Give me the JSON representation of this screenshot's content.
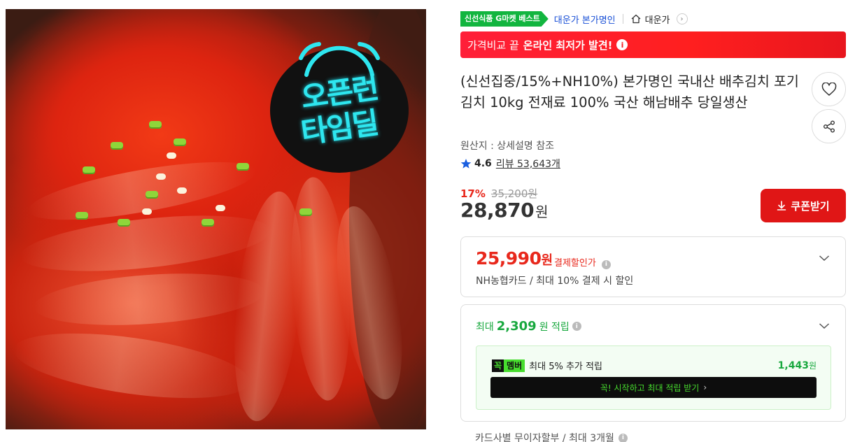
{
  "image": {
    "badge_line1": "오픈런",
    "badge_line2": "타임딜",
    "clock_icon": "alarm-clock-icon"
  },
  "tags": {
    "best_badge": "신선식품 G마켓 베스트",
    "brand": "대운가 본가명인",
    "home_label": "대운가"
  },
  "banner": {
    "prefix": "가격비교 끝",
    "highlight": "온라인 최저가 발견!"
  },
  "product": {
    "title": "(신선집중/15%+NH10%) 본가명인 국내산 배추김치 포기김치 10kg 전재료 100% 국산 해남배추 당일생산",
    "origin": "원산지 : 상세설명 참조",
    "rating": "4.6",
    "review_label": "리뷰 53,643개"
  },
  "price": {
    "discount_rate": "17%",
    "original": "35,200원",
    "final_number": "28,870",
    "final_unit": "원",
    "coupon_label": "쿠폰받기"
  },
  "payment_box": {
    "price_number": "25,990",
    "price_unit": "원",
    "label": "결제할인가",
    "description": "NH농협카드 / 최대 10% 결제 시 할인"
  },
  "points_box": {
    "prefix": "최대",
    "amount": "2,309",
    "suffix": "원 적립",
    "member_badge_a": "꼭",
    "member_badge_b": "멤버",
    "member_text": "최대 5% 추가 적립",
    "member_amount": "1,443",
    "member_amount_unit": "원",
    "start_button": "꼭! 시작하고 최대 적립 받기"
  },
  "installment": "카드사별 무이자할부 / 최대 3개월",
  "colors": {
    "accent_red": "#e8281c",
    "green": "#18a83e",
    "banner_red": "#ff1f38",
    "brand_blue": "#174ed6"
  }
}
